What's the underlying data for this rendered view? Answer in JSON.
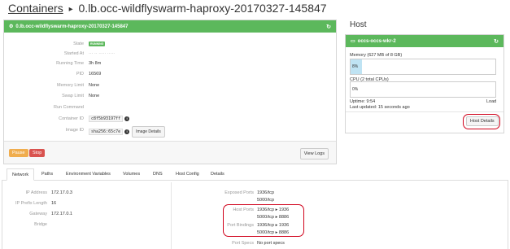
{
  "breadcrumb": {
    "link": "Containers",
    "separator": "▸",
    "current": "0.lb.occ-wildflyswarm-haproxy-20170327-145847"
  },
  "container_panel": {
    "title": "0.lb.occ-wildflyswarm-haproxy-20170327-145847",
    "rows": {
      "state": {
        "label": "State",
        "value": "RUNNING"
      },
      "started_at": {
        "label": "Started At",
        "value": "··· ·· ····· ·····"
      },
      "running_time": {
        "label": "Running Time",
        "value": "3h 8m"
      },
      "pid": {
        "label": "PID",
        "value": "16569"
      },
      "memory_limit": {
        "label": "Memory Limit",
        "value": "None"
      },
      "swap_limit": {
        "label": "Swap Limit",
        "value": "None"
      },
      "run_command": {
        "label": "Run Command",
        "value": ""
      },
      "container_id": {
        "label": "Container ID",
        "value": "c8f5b93197ff"
      },
      "image_id": {
        "label": "Image ID",
        "value": "sha256:65c7e"
      }
    },
    "image_details_button": "Image Details",
    "pause_button": "Pause",
    "stop_button": "Stop",
    "view_logs_button": "View Logs"
  },
  "host": {
    "heading": "Host",
    "panel_title": "occs-occs-wkr-2",
    "memory_label": "Memory (627 MB of 8 GB)",
    "memory_percent_text": "8%",
    "memory_fraction": 0.08,
    "cpu_label": "CPU (2 total CPUs)",
    "cpu_percent_text": "0%",
    "cpu_fraction": 0.0,
    "uptime": "Uptime: 9:54",
    "last_updated": "Last updated: 15 seconds ago",
    "load_label": "Load",
    "host_details_button": "Host Details"
  },
  "tabs": [
    "Network",
    "Paths",
    "Environment Variables",
    "Volumes",
    "DNS",
    "Host Config",
    "Details"
  ],
  "active_tab": "Network",
  "network": {
    "ip_address": {
      "label": "IP Address",
      "value": "172.17.0.3"
    },
    "ip_prefix_length": {
      "label": "IP Prefix Length",
      "value": "16"
    },
    "gateway": {
      "label": "Gateway",
      "value": "172.17.0.1"
    },
    "bridge": {
      "label": "Bridge",
      "value": ""
    },
    "exposed_ports": {
      "label": "Exposed Ports",
      "values": [
        "1936/tcp",
        "5000/tcp"
      ]
    },
    "host_ports": {
      "label": "Host Ports",
      "values": [
        "1936/tcp ▸ 1936",
        "5000/tcp ▸ 8886"
      ]
    },
    "port_bindings": {
      "label": "Port Bindings",
      "values": [
        "1936/tcp ▸ 1936",
        "5000/tcp ▸ 8886"
      ]
    },
    "port_specs": {
      "label": "Port Specs",
      "value": "No port specs"
    }
  }
}
